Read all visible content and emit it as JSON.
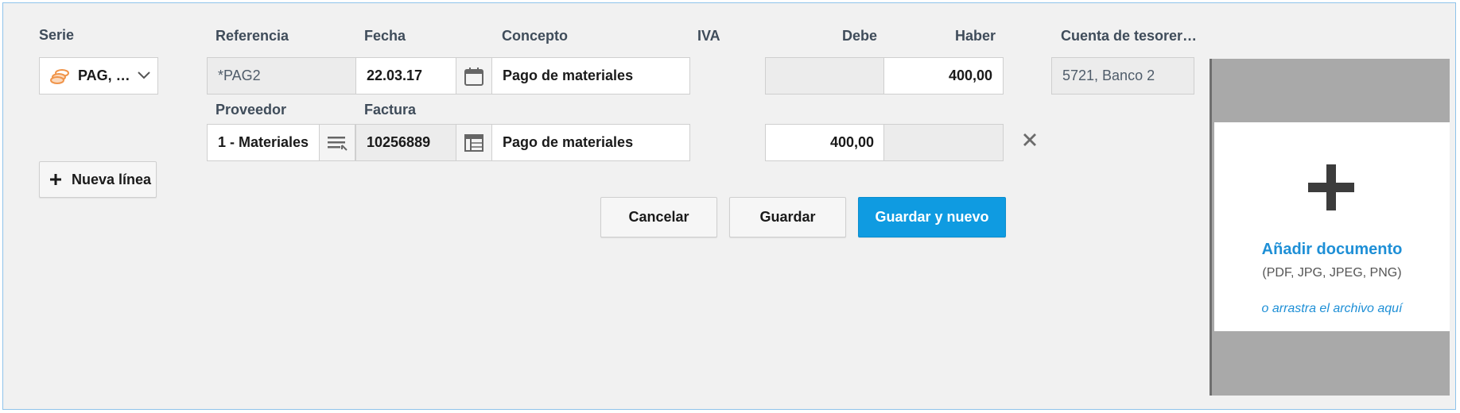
{
  "labels": {
    "serie": "Serie",
    "referencia": "Referencia",
    "fecha": "Fecha",
    "concepto": "Concepto",
    "iva": "IVA",
    "debe": "Debe",
    "haber": "Haber",
    "cuenta": "Cuenta de tesorer…",
    "proveedor": "Proveedor",
    "factura": "Factura"
  },
  "row1": {
    "serie_value": "PAG, …",
    "referencia": "*PAG2",
    "fecha": "22.03.17",
    "concepto": "Pago de materiales",
    "debe": "",
    "haber": "400,00",
    "cuenta": "5721, Banco 2"
  },
  "row2": {
    "proveedor": "1 - Materiales",
    "factura": "10256889",
    "concepto": "Pago de materiales",
    "debe": "400,00",
    "haber": ""
  },
  "actions": {
    "nueva_linea": "Nueva línea",
    "cancelar": "Cancelar",
    "guardar": "Guardar",
    "guardar_nuevo": "Guardar y nuevo"
  },
  "upload": {
    "title": "Añadir documento",
    "formats": "(PDF, JPG, JPEG, PNG)",
    "drag_hint": "o arrastra el archivo aquí"
  },
  "icons": {
    "serie": "coins-icon",
    "dropdown": "chevron-down-icon",
    "fecha": "calendar-icon",
    "proveedor": "list-icon",
    "factura": "invoice-grid-icon",
    "remove": "close-icon",
    "add_line": "plus-icon",
    "upload": "plus-icon"
  },
  "colors": {
    "accent": "#0f9be1",
    "link": "#1e8fd6",
    "serie_icon": "#f0954b"
  }
}
